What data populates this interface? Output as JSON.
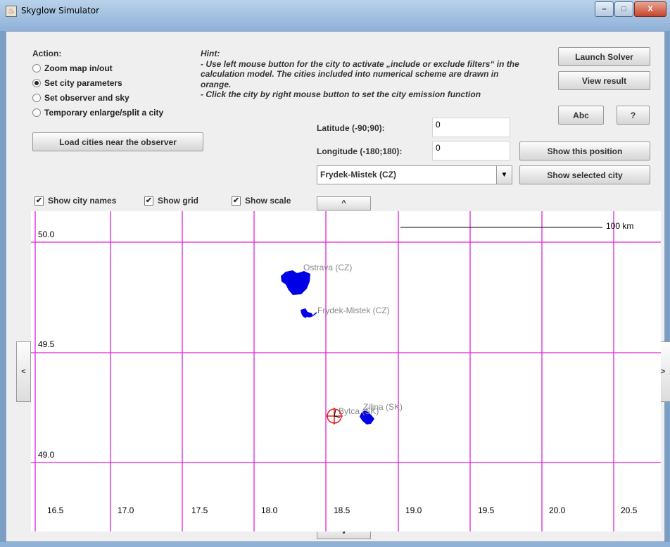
{
  "window": {
    "title": "Skyglow Simulator",
    "minimize": "–",
    "maximize": "□",
    "close": "X"
  },
  "action": {
    "label": "Action:",
    "options": [
      {
        "label": "Zoom map in/out",
        "selected": false
      },
      {
        "label": "Set city parameters",
        "selected": true
      },
      {
        "label": "Set observer and sky",
        "selected": false
      },
      {
        "label": "Temporary enlarge/split a city",
        "selected": false
      }
    ],
    "load_cities_button": "Load cities near the observer"
  },
  "hint": {
    "title": "Hint:",
    "line1": "- Use left mouse button for the city to activate „include or exclude filters“ in the",
    "line2": "calculation model. The cities included into numerical scheme are drawn in",
    "line3": "orange.",
    "line4": "- Click the city by right mouse button to set the city emission function"
  },
  "buttons": {
    "launch_solver": "Launch Solver",
    "view_result": "View result",
    "abc": "Abc",
    "help": "?",
    "show_position": "Show this position",
    "show_city": "Show selected city"
  },
  "coords": {
    "latitude_label": "Latitude (-90;90):",
    "latitude_value": "0",
    "longitude_label": "Longitude (-180;180):",
    "longitude_value": "0"
  },
  "city_select": {
    "selected": "Frydek-Mistek (CZ)"
  },
  "checkboxes": {
    "city_names": "Show city names",
    "grid": "Show grid",
    "scale": "Show scale",
    "check_mark": "✔"
  },
  "nav": {
    "up": "^",
    "down": "v",
    "left": "<",
    "right": ">"
  },
  "map": {
    "scale_label": "100 km",
    "lat_labels": [
      "50.0",
      "49.5",
      "49.0"
    ],
    "lon_labels": [
      "16.5",
      "17.0",
      "17.5",
      "18.0",
      "18.5",
      "19.0",
      "19.5",
      "20.0",
      "20.5"
    ],
    "cities": [
      {
        "name": "Ostrava (CZ)"
      },
      {
        "name": "Frydek-Mistek (CZ)"
      },
      {
        "name": "Zilina (SK)"
      },
      {
        "name": "Bytca (SK)"
      }
    ],
    "grid_color": "#dd22dd",
    "city_color": "#0000e6",
    "observer_color": "#e02020"
  }
}
